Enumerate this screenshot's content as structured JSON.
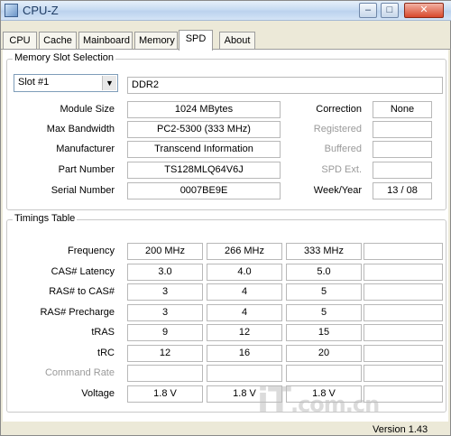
{
  "window": {
    "title": "CPU-Z",
    "min": "–",
    "max": "□",
    "close": "✕"
  },
  "tabs": [
    {
      "label": "CPU"
    },
    {
      "label": "Cache"
    },
    {
      "label": "Mainboard"
    },
    {
      "label": "Memory"
    },
    {
      "label": "SPD"
    },
    {
      "label": "About"
    }
  ],
  "slot_selection": {
    "title": "Memory Slot Selection",
    "slot_value": "Slot #1",
    "type": "DDR2",
    "labels": {
      "module_size": "Module Size",
      "max_bandwidth": "Max Bandwidth",
      "manufacturer": "Manufacturer",
      "part_number": "Part Number",
      "serial_number": "Serial Number",
      "correction": "Correction",
      "registered": "Registered",
      "buffered": "Buffered",
      "spd_ext": "SPD Ext.",
      "week_year": "Week/Year"
    },
    "values": {
      "module_size": "1024 MBytes",
      "max_bandwidth": "PC2-5300 (333 MHz)",
      "manufacturer": "Transcend Information",
      "part_number": "TS128MLQ64V6J",
      "serial_number": "0007BE9E",
      "correction": "None",
      "registered": "",
      "buffered": "",
      "spd_ext": "",
      "week_year": "13 / 08"
    }
  },
  "timings": {
    "title": "Timings Table",
    "rows": [
      {
        "label": "Frequency",
        "values": [
          "200 MHz",
          "266 MHz",
          "333 MHz",
          ""
        ]
      },
      {
        "label": "CAS# Latency",
        "values": [
          "3.0",
          "4.0",
          "5.0",
          ""
        ]
      },
      {
        "label": "RAS# to CAS#",
        "values": [
          "3",
          "4",
          "5",
          ""
        ]
      },
      {
        "label": "RAS# Precharge",
        "values": [
          "3",
          "4",
          "5",
          ""
        ]
      },
      {
        "label": "tRAS",
        "values": [
          "9",
          "12",
          "15",
          ""
        ]
      },
      {
        "label": "tRC",
        "values": [
          "12",
          "16",
          "20",
          ""
        ]
      },
      {
        "label": "Command Rate",
        "values": [
          "",
          "",
          "",
          ""
        ]
      },
      {
        "label": "Voltage",
        "values": [
          "1.8 V",
          "1.8 V",
          "1.8 V",
          ""
        ]
      }
    ]
  },
  "footer": {
    "version": "Version 1.43"
  },
  "watermark": {
    "main": "iT",
    "suffix": ".com.cn"
  }
}
